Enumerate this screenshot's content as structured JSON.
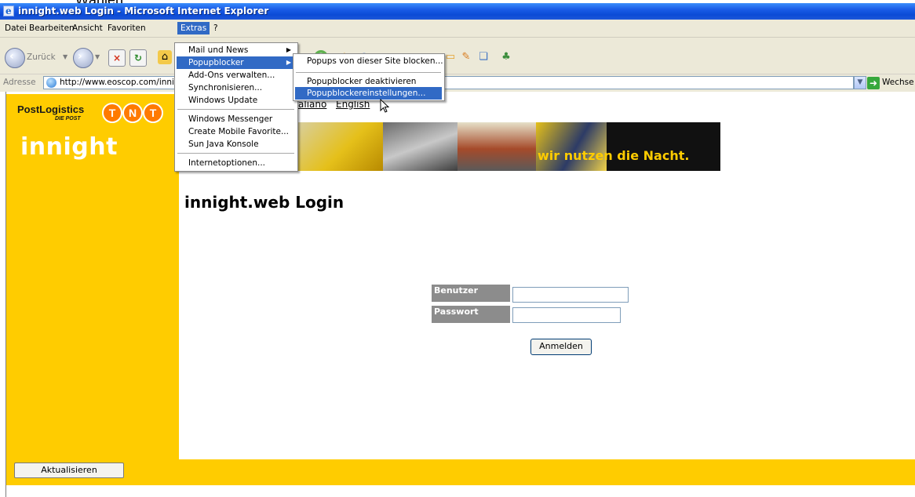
{
  "caption": "Wählen",
  "window": {
    "title": "innight.web Login - Microsoft Internet Explorer"
  },
  "menubar": {
    "items": [
      "Datei",
      "Bearbeiten",
      "Ansicht",
      "Favoriten",
      "Extras",
      "?"
    ],
    "active": "Extras"
  },
  "toolbar": {
    "back_label": "Zurück"
  },
  "address": {
    "label": "Adresse",
    "value": "http://www.eoscop.com/innight",
    "go_label": "Wechse"
  },
  "extras_menu": {
    "items": [
      "Mail und News",
      "Popupblocker",
      "Add-Ons verwalten...",
      "Synchronisieren...",
      "Windows Update",
      "Windows Messenger",
      "Create Mobile Favorite...",
      "Sun Java Konsole",
      "Internetoptionen..."
    ],
    "highlighted": "Popupblocker"
  },
  "popup_submenu": {
    "items": [
      "Popups von dieser Site blocken...",
      "Popupblocker deaktivieren",
      "Popupblockereinstellungen..."
    ],
    "highlighted": "Popupblockereinstellungen..."
  },
  "page": {
    "logo_postlogistics": "PostLogistics",
    "logo_diepost": "DIE POST",
    "logo_tnt": [
      "T",
      "N",
      "T"
    ],
    "logo_innight": "innight",
    "lang_italiano": "aliano",
    "lang_english": "English",
    "banner_text": "wir nutzen die Nacht.",
    "heading": "innight.web Login",
    "user_label": "Benutzer",
    "user_value": "",
    "password_label": "Passwort",
    "password_value": "",
    "login_button": "Anmelden",
    "refresh_button": "Aktualisieren"
  },
  "colors": {
    "brand_yellow": "#ffcc00",
    "tnt_orange": "#ff7a00",
    "menu_highlight": "#316ac5",
    "xp_titlebar": "#0b4bd6"
  }
}
